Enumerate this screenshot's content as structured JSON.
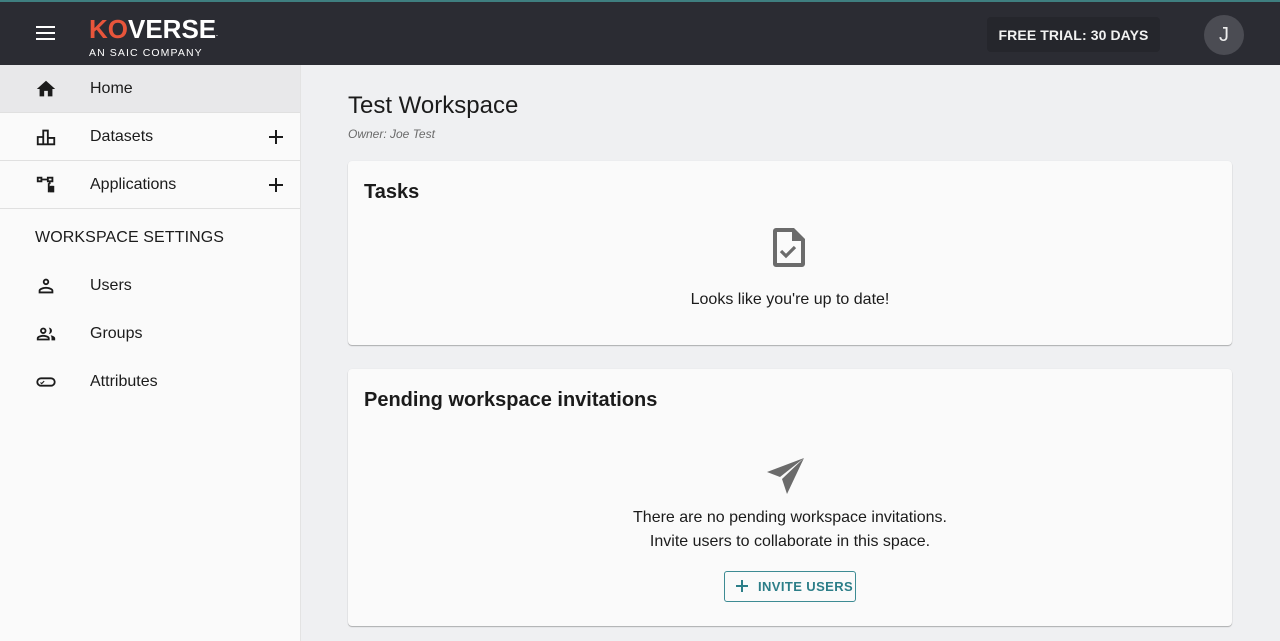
{
  "header": {
    "logo": {
      "prefix": "KO",
      "rest": "VERSE",
      "trademark": ".",
      "tagline": "AN SAIC COMPANY"
    },
    "trial_badge": "FREE TRIAL: 30 DAYS",
    "avatar_initial": "J"
  },
  "sidebar": {
    "items": [
      {
        "label": "Home",
        "icon": "home-icon",
        "active": true
      },
      {
        "label": "Datasets",
        "icon": "bar-chart-icon",
        "has_add": true
      },
      {
        "label": "Applications",
        "icon": "account-tree-icon",
        "has_add": true
      }
    ],
    "settings_title": "WORKSPACE SETTINGS",
    "settings_items": [
      {
        "label": "Users",
        "icon": "person-icon"
      },
      {
        "label": "Groups",
        "icon": "people-icon"
      },
      {
        "label": "Attributes",
        "icon": "label-check-icon"
      }
    ]
  },
  "main": {
    "title": "Test Workspace",
    "owner": "Owner: Joe Test",
    "tasks_card": {
      "title": "Tasks",
      "icon": "file-check-icon",
      "empty_message": "Looks like you're up to date!"
    },
    "invitations_card": {
      "title": "Pending workspace invitations",
      "icon": "send-icon",
      "empty_line1": "There are no pending workspace invitations.",
      "empty_line2": "Invite users to collaborate in this space.",
      "button_label": "INVITE USERS"
    }
  },
  "colors": {
    "appbar": "#2b2c33",
    "brand_orange": "#e8553b",
    "accent_teal": "#2c7e88",
    "page_bg": "#eff0f2",
    "card_bg": "#fafafa"
  }
}
